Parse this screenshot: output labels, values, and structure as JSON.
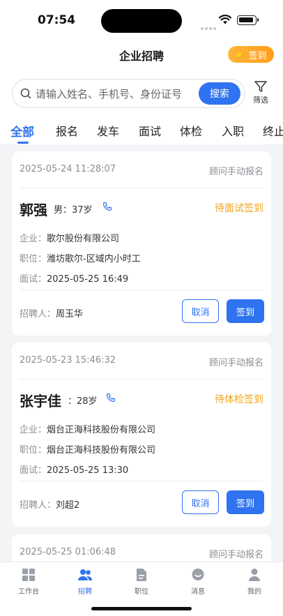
{
  "status_bar": {
    "time": "07:54"
  },
  "header": {
    "title": "企业招聘",
    "checkin_label": "签到"
  },
  "search": {
    "placeholder": "请输入姓名、手机号、身份证号",
    "button_label": "搜索",
    "filter_label": "筛选"
  },
  "tabs": [
    {
      "label": "全部",
      "active": true
    },
    {
      "label": "报名",
      "active": false
    },
    {
      "label": "发车",
      "active": false
    },
    {
      "label": "面试",
      "active": false
    },
    {
      "label": "体检",
      "active": false
    },
    {
      "label": "入职",
      "active": false
    },
    {
      "label": "终止",
      "active": false
    }
  ],
  "labels": {
    "company": "企业：",
    "position": "职位：",
    "interview": "面试：",
    "recruiter": "招聘人：",
    "cancel": "取消",
    "sign_in": "签到"
  },
  "cards": [
    {
      "time": "2025-05-24 11:28:07",
      "source": "顾问手动报名",
      "name": "郭强",
      "gender_age": "男：37岁",
      "status": "待面试签到",
      "company": "歌尔股份有限公司",
      "position": "潍坊歌尔-区域内小时工",
      "interview": "2025-05-25 16:49",
      "recruiter": "周玉华"
    },
    {
      "time": "2025-05-23 15:46:32",
      "source": "顾问手动报名",
      "name": "张宇佳",
      "gender_age": "：28岁",
      "status": "待体检签到",
      "company": "烟台正海科技股份有限公司",
      "position": "烟台正海科技股份有限公司",
      "interview": "2025-05-25 13:30",
      "recruiter": "刘超2"
    },
    {
      "time": "2025-05-25 01:06:48",
      "source": "顾问手动报名"
    }
  ],
  "tabbar": [
    {
      "label": "工作台",
      "icon": "grid-icon",
      "active": false
    },
    {
      "label": "招聘",
      "icon": "users-icon",
      "active": true
    },
    {
      "label": "职位",
      "icon": "document-icon",
      "active": false
    },
    {
      "label": "消息",
      "icon": "chat-icon",
      "active": false
    },
    {
      "label": "我的",
      "icon": "person-icon",
      "active": false
    }
  ],
  "colors": {
    "primary": "#2f73f0",
    "warning": "#f0a41e",
    "checkin_orange": "#ff9c1a"
  }
}
